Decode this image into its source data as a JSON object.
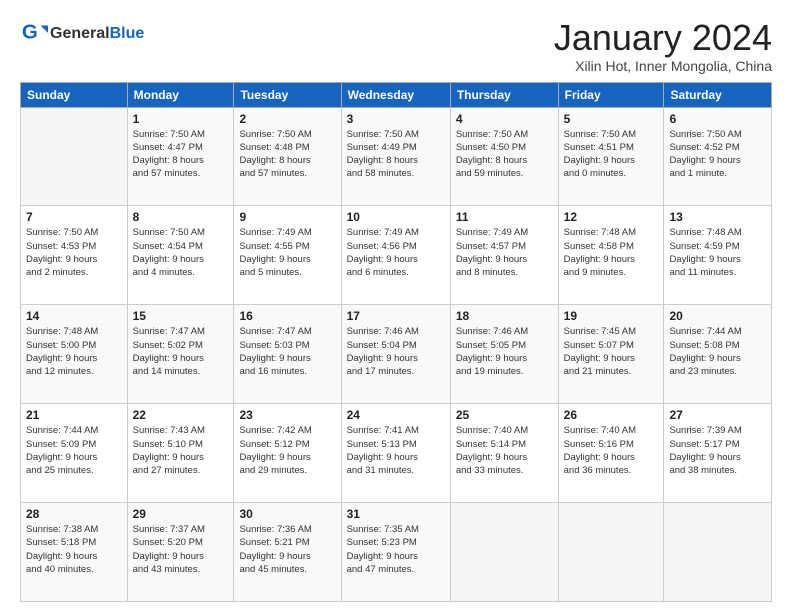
{
  "header": {
    "logo_general": "General",
    "logo_blue": "Blue",
    "month_title": "January 2024",
    "location": "Xilin Hot, Inner Mongolia, China"
  },
  "days_of_week": [
    "Sunday",
    "Monday",
    "Tuesday",
    "Wednesday",
    "Thursday",
    "Friday",
    "Saturday"
  ],
  "weeks": [
    [
      {
        "day": "",
        "info": ""
      },
      {
        "day": "1",
        "info": "Sunrise: 7:50 AM\nSunset: 4:47 PM\nDaylight: 8 hours\nand 57 minutes."
      },
      {
        "day": "2",
        "info": "Sunrise: 7:50 AM\nSunset: 4:48 PM\nDaylight: 8 hours\nand 57 minutes."
      },
      {
        "day": "3",
        "info": "Sunrise: 7:50 AM\nSunset: 4:49 PM\nDaylight: 8 hours\nand 58 minutes."
      },
      {
        "day": "4",
        "info": "Sunrise: 7:50 AM\nSunset: 4:50 PM\nDaylight: 8 hours\nand 59 minutes."
      },
      {
        "day": "5",
        "info": "Sunrise: 7:50 AM\nSunset: 4:51 PM\nDaylight: 9 hours\nand 0 minutes."
      },
      {
        "day": "6",
        "info": "Sunrise: 7:50 AM\nSunset: 4:52 PM\nDaylight: 9 hours\nand 1 minute."
      }
    ],
    [
      {
        "day": "7",
        "info": "Sunrise: 7:50 AM\nSunset: 4:53 PM\nDaylight: 9 hours\nand 2 minutes."
      },
      {
        "day": "8",
        "info": "Sunrise: 7:50 AM\nSunset: 4:54 PM\nDaylight: 9 hours\nand 4 minutes."
      },
      {
        "day": "9",
        "info": "Sunrise: 7:49 AM\nSunset: 4:55 PM\nDaylight: 9 hours\nand 5 minutes."
      },
      {
        "day": "10",
        "info": "Sunrise: 7:49 AM\nSunset: 4:56 PM\nDaylight: 9 hours\nand 6 minutes."
      },
      {
        "day": "11",
        "info": "Sunrise: 7:49 AM\nSunset: 4:57 PM\nDaylight: 9 hours\nand 8 minutes."
      },
      {
        "day": "12",
        "info": "Sunrise: 7:48 AM\nSunset: 4:58 PM\nDaylight: 9 hours\nand 9 minutes."
      },
      {
        "day": "13",
        "info": "Sunrise: 7:48 AM\nSunset: 4:59 PM\nDaylight: 9 hours\nand 11 minutes."
      }
    ],
    [
      {
        "day": "14",
        "info": "Sunrise: 7:48 AM\nSunset: 5:00 PM\nDaylight: 9 hours\nand 12 minutes."
      },
      {
        "day": "15",
        "info": "Sunrise: 7:47 AM\nSunset: 5:02 PM\nDaylight: 9 hours\nand 14 minutes."
      },
      {
        "day": "16",
        "info": "Sunrise: 7:47 AM\nSunset: 5:03 PM\nDaylight: 9 hours\nand 16 minutes."
      },
      {
        "day": "17",
        "info": "Sunrise: 7:46 AM\nSunset: 5:04 PM\nDaylight: 9 hours\nand 17 minutes."
      },
      {
        "day": "18",
        "info": "Sunrise: 7:46 AM\nSunset: 5:05 PM\nDaylight: 9 hours\nand 19 minutes."
      },
      {
        "day": "19",
        "info": "Sunrise: 7:45 AM\nSunset: 5:07 PM\nDaylight: 9 hours\nand 21 minutes."
      },
      {
        "day": "20",
        "info": "Sunrise: 7:44 AM\nSunset: 5:08 PM\nDaylight: 9 hours\nand 23 minutes."
      }
    ],
    [
      {
        "day": "21",
        "info": "Sunrise: 7:44 AM\nSunset: 5:09 PM\nDaylight: 9 hours\nand 25 minutes."
      },
      {
        "day": "22",
        "info": "Sunrise: 7:43 AM\nSunset: 5:10 PM\nDaylight: 9 hours\nand 27 minutes."
      },
      {
        "day": "23",
        "info": "Sunrise: 7:42 AM\nSunset: 5:12 PM\nDaylight: 9 hours\nand 29 minutes."
      },
      {
        "day": "24",
        "info": "Sunrise: 7:41 AM\nSunset: 5:13 PM\nDaylight: 9 hours\nand 31 minutes."
      },
      {
        "day": "25",
        "info": "Sunrise: 7:40 AM\nSunset: 5:14 PM\nDaylight: 9 hours\nand 33 minutes."
      },
      {
        "day": "26",
        "info": "Sunrise: 7:40 AM\nSunset: 5:16 PM\nDaylight: 9 hours\nand 36 minutes."
      },
      {
        "day": "27",
        "info": "Sunrise: 7:39 AM\nSunset: 5:17 PM\nDaylight: 9 hours\nand 38 minutes."
      }
    ],
    [
      {
        "day": "28",
        "info": "Sunrise: 7:38 AM\nSunset: 5:18 PM\nDaylight: 9 hours\nand 40 minutes."
      },
      {
        "day": "29",
        "info": "Sunrise: 7:37 AM\nSunset: 5:20 PM\nDaylight: 9 hours\nand 43 minutes."
      },
      {
        "day": "30",
        "info": "Sunrise: 7:36 AM\nSunset: 5:21 PM\nDaylight: 9 hours\nand 45 minutes."
      },
      {
        "day": "31",
        "info": "Sunrise: 7:35 AM\nSunset: 5:23 PM\nDaylight: 9 hours\nand 47 minutes."
      },
      {
        "day": "",
        "info": ""
      },
      {
        "day": "",
        "info": ""
      },
      {
        "day": "",
        "info": ""
      }
    ]
  ]
}
